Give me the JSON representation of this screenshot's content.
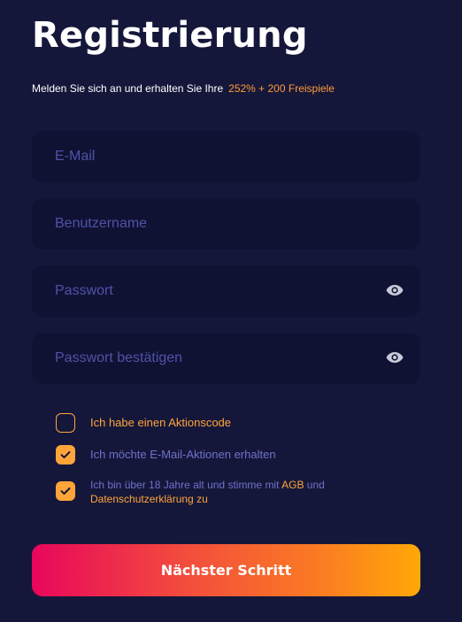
{
  "header": {
    "title": "Registrierung",
    "subtitle": "Melden Sie sich an und erhalten Sie Ihre",
    "promo": "252% + 200 Freispiele"
  },
  "form": {
    "email_placeholder": "E-Mail",
    "username_placeholder": "Benutzername",
    "password_placeholder": "Passwort",
    "confirm_password_placeholder": "Passwort bestätigen"
  },
  "checkboxes": {
    "promo_code": {
      "label": "Ich habe einen Aktionscode",
      "checked": false
    },
    "email_promotions": {
      "label": "Ich möchte E-Mail-Aktionen erhalten",
      "checked": true
    },
    "terms": {
      "label_before": "Ich bin über 18 Jahre alt und stimme mit ",
      "agb_link": "AGB",
      "label_and": " und ",
      "privacy_link": "Datenschutzerklärung zu",
      "checked": true
    }
  },
  "submit_label": "Nächster Schritt",
  "colors": {
    "background": "#15173a",
    "field_background": "#101233",
    "placeholder": "#4f52a8",
    "accent_orange": "#ffa53a",
    "muted_text": "#6e72c8",
    "gradient_start": "#e8065c",
    "gradient_end": "#ffa807"
  },
  "icons": {
    "password_toggle": "eye-icon",
    "checkbox_mark": "checkmark-icon"
  }
}
